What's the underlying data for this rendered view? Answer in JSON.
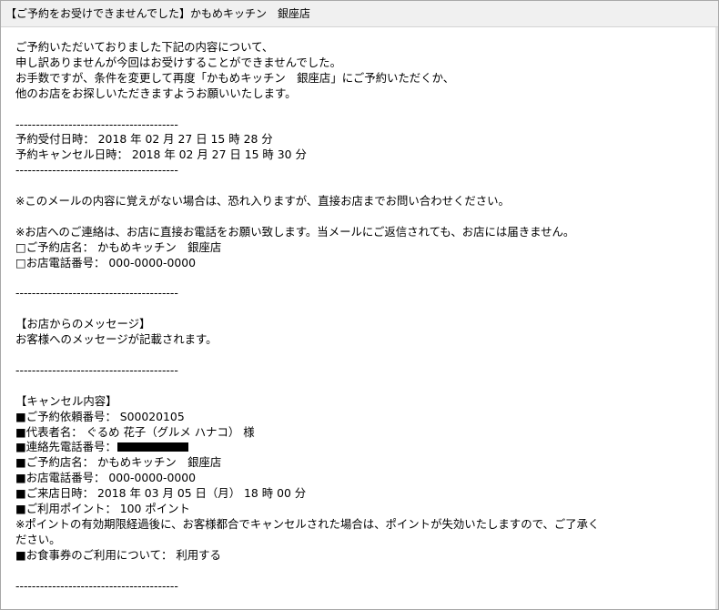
{
  "email": {
    "subject": "【ご予約をお受けできませんでした】かもめキッチン　銀座店",
    "body": {
      "intro": [
        "ご予約いただいておりました下記の内容について、",
        "申し訳ありませんが今回はお受けすることができませんでした。",
        "お手数ですが、条件を変更して再度「かもめキッチン　銀座店」にご予約いただくか、",
        "他のお店をお探しいただきますようお願いいたします。"
      ],
      "divider": "----------------------------------------",
      "reservation_received": "予約受付日時： 2018 年 02 月 27 日 15 時 28 分",
      "cancellation_datetime": "予約キャンセル日時： 2018 年 02 月 27 日 15 時 30 分",
      "notice_unrecognized": "※このメールの内容に覚えがない場合は、恐れ入りますが、直接お店までお問い合わせください。",
      "notice_contact": "※お店へのご連絡は、お店に直接お電話をお願い致します。当メールにご返信されても、お店には届きません。",
      "contact_store_name": "□ご予約店名： かもめキッチン　銀座店",
      "contact_store_phone": "□お店電話番号： 000-0000-0000",
      "message_heading": "【お店からのメッセージ】",
      "message_text": "お客様へのメッセージが記載されます。",
      "cancel_heading": "【キャンセル内容】",
      "request_number": "■ご予約依頼番号： S00020105",
      "representative": "■代表者名： ぐるめ 花子（グルメ ハナコ） 様",
      "contact_phone_label": "■連絡先電話番号：",
      "cancel_store_name": "■ご予約店名： かもめキッチン　銀座店",
      "cancel_store_phone": "■お店電話番号： 000-0000-0000",
      "visit_datetime": "■ご来店日時： 2018 年 03 月 05 日（月） 18 時 00 分",
      "points_used": "■ご利用ポイント： 100 ポイント",
      "points_notice_1": "※ポイントの有効期限経過後に、お客様都合でキャンセルされた場合は、ポイントが失効いたしますので、ご了承く",
      "points_notice_2": "ださい。",
      "meal_ticket": "■お食事券のご利用について： 利用する"
    }
  }
}
